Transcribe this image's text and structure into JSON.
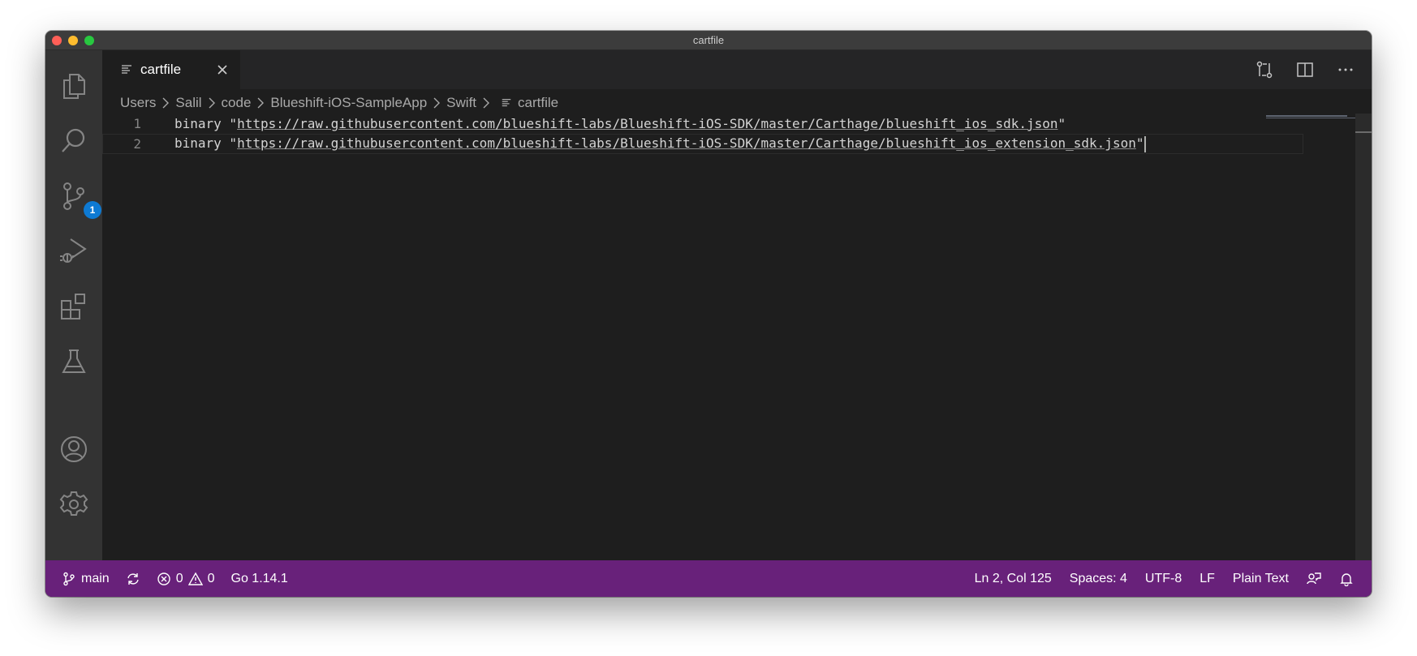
{
  "window": {
    "title": "cartfile"
  },
  "activity_bar": {
    "items": [
      {
        "icon": "files-icon"
      },
      {
        "icon": "search-icon"
      },
      {
        "icon": "source-control-icon",
        "badge": "1"
      },
      {
        "icon": "run-debug-icon"
      },
      {
        "icon": "extensions-icon"
      },
      {
        "icon": "testing-icon"
      },
      {
        "icon": "accounts-icon"
      },
      {
        "icon": "settings-gear-icon"
      }
    ]
  },
  "tab": {
    "label": "cartfile"
  },
  "breadcrumb": {
    "items": [
      "Users",
      "Salil",
      "code",
      "Blueshift-iOS-SampleApp",
      "Swift"
    ],
    "file": "cartfile"
  },
  "editor": {
    "lines": [
      {
        "number": "1",
        "prefix": "binary \"",
        "url": "https://raw.githubusercontent.com/blueshift-labs/Blueshift-iOS-SDK/master/Carthage/blueshift_ios_sdk.json",
        "suffix": "\""
      },
      {
        "number": "2",
        "prefix": "binary \"",
        "url": "https://raw.githubusercontent.com/blueshift-labs/Blueshift-iOS-SDK/master/Carthage/blueshift_ios_extension_sdk.json",
        "suffix": "\""
      }
    ]
  },
  "status_bar": {
    "branch": "main",
    "errors": "0",
    "warnings": "0",
    "go_version": "Go 1.14.1",
    "position": "Ln 2, Col 125",
    "indent": "Spaces: 4",
    "encoding": "UTF-8",
    "eol": "LF",
    "language": "Plain Text"
  },
  "colors": {
    "status_bar": "#68217a",
    "editor_bg": "#1e1e1e",
    "activity_bar": "#333333",
    "badge": "#0e7ad3"
  }
}
